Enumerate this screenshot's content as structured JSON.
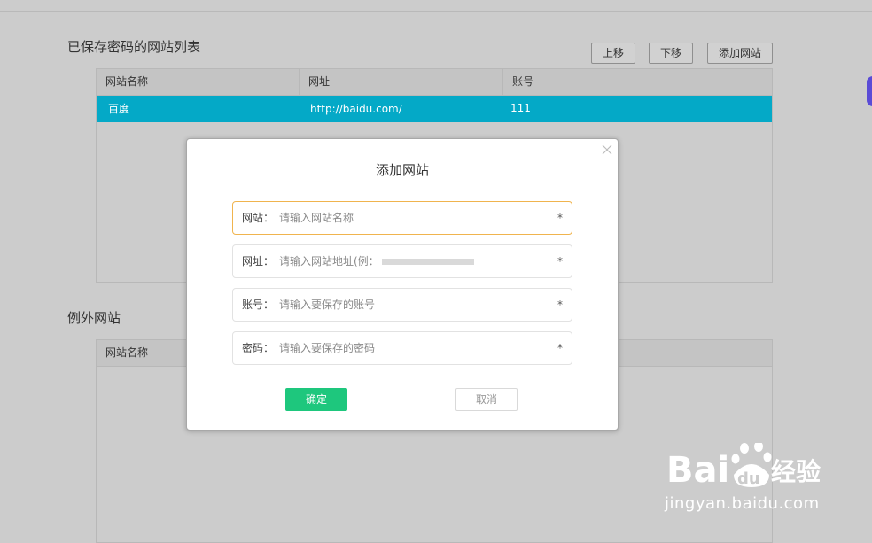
{
  "saved_section": {
    "title": "已保存密码的网站列表",
    "buttons": {
      "up": "上移",
      "down": "下移",
      "add": "添加网站"
    },
    "columns": [
      "网站名称",
      "网址",
      "账号"
    ],
    "rows": [
      {
        "name": "百度",
        "url": "http://baidu.com/",
        "account": "111"
      }
    ],
    "selected_row_color": "#04a9c7"
  },
  "exception_section": {
    "title": "例外网站",
    "columns": [
      "网站名称"
    ]
  },
  "modal": {
    "title": "添加网站",
    "fields": [
      {
        "label": "网站：",
        "placeholder": "请输入网站名称",
        "required": "*"
      },
      {
        "label": "网址：",
        "placeholder": "请输入网站地址(例：",
        "required": "*"
      },
      {
        "label": "账号：",
        "placeholder": "请输入要保存的账号",
        "required": "*"
      },
      {
        "label": "密码：",
        "placeholder": "请输入要保存的密码",
        "required": "*"
      }
    ],
    "confirm": "确定",
    "cancel": "取消",
    "confirm_color": "#1ec77d",
    "focus_color": "#f0b44e"
  },
  "watermark": {
    "brand_left": "Bai",
    "brand_right": "du",
    "brand_cn": "经验",
    "url": "jingyan.baidu.com"
  }
}
